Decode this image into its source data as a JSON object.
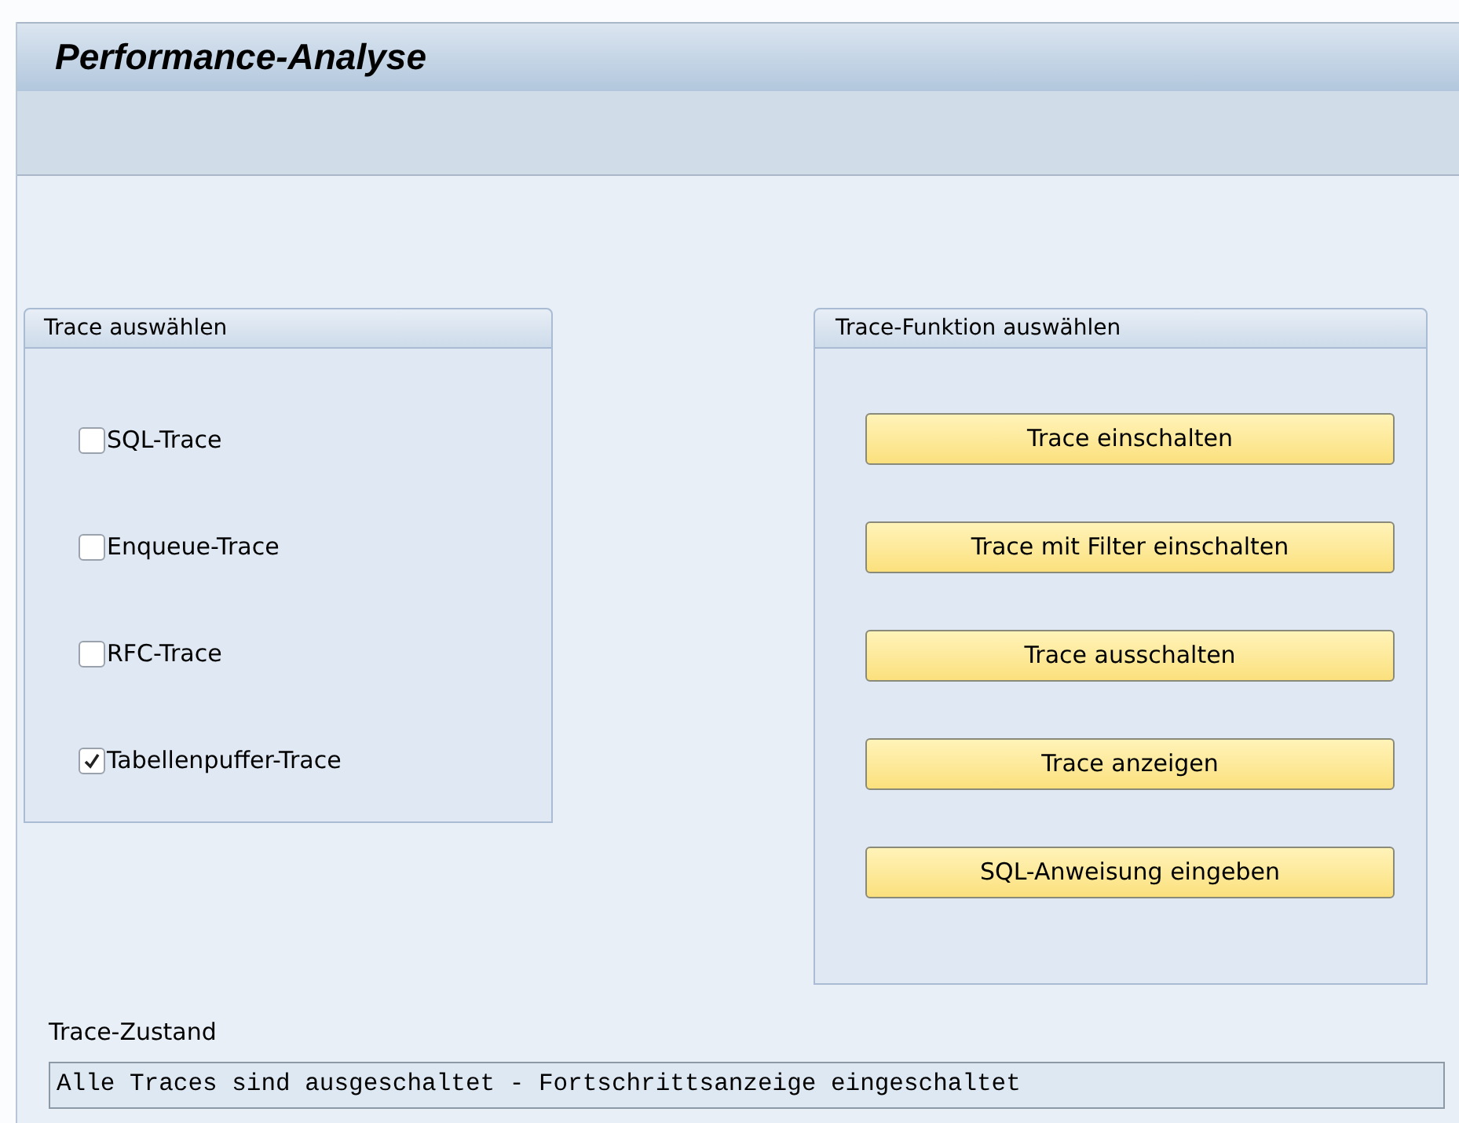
{
  "window": {
    "title": "Performance-Analyse"
  },
  "trace_select": {
    "title": "Trace auswählen",
    "options": [
      {
        "label": "SQL-Trace",
        "checked": false
      },
      {
        "label": "Enqueue-Trace",
        "checked": false
      },
      {
        "label": "RFC-Trace",
        "checked": false
      },
      {
        "label": "Tabellenpuffer-Trace",
        "checked": true
      }
    ]
  },
  "trace_function": {
    "title": "Trace-Funktion auswählen",
    "buttons": [
      "Trace einschalten",
      "Trace mit Filter einschalten",
      "Trace ausschalten",
      "Trace anzeigen",
      "SQL-Anweisung eingeben"
    ]
  },
  "trace_state": {
    "label": "Trace-Zustand",
    "value": "Alle Traces sind ausgeschaltet - Fortschrittsanzeige eingeschaltet"
  }
}
